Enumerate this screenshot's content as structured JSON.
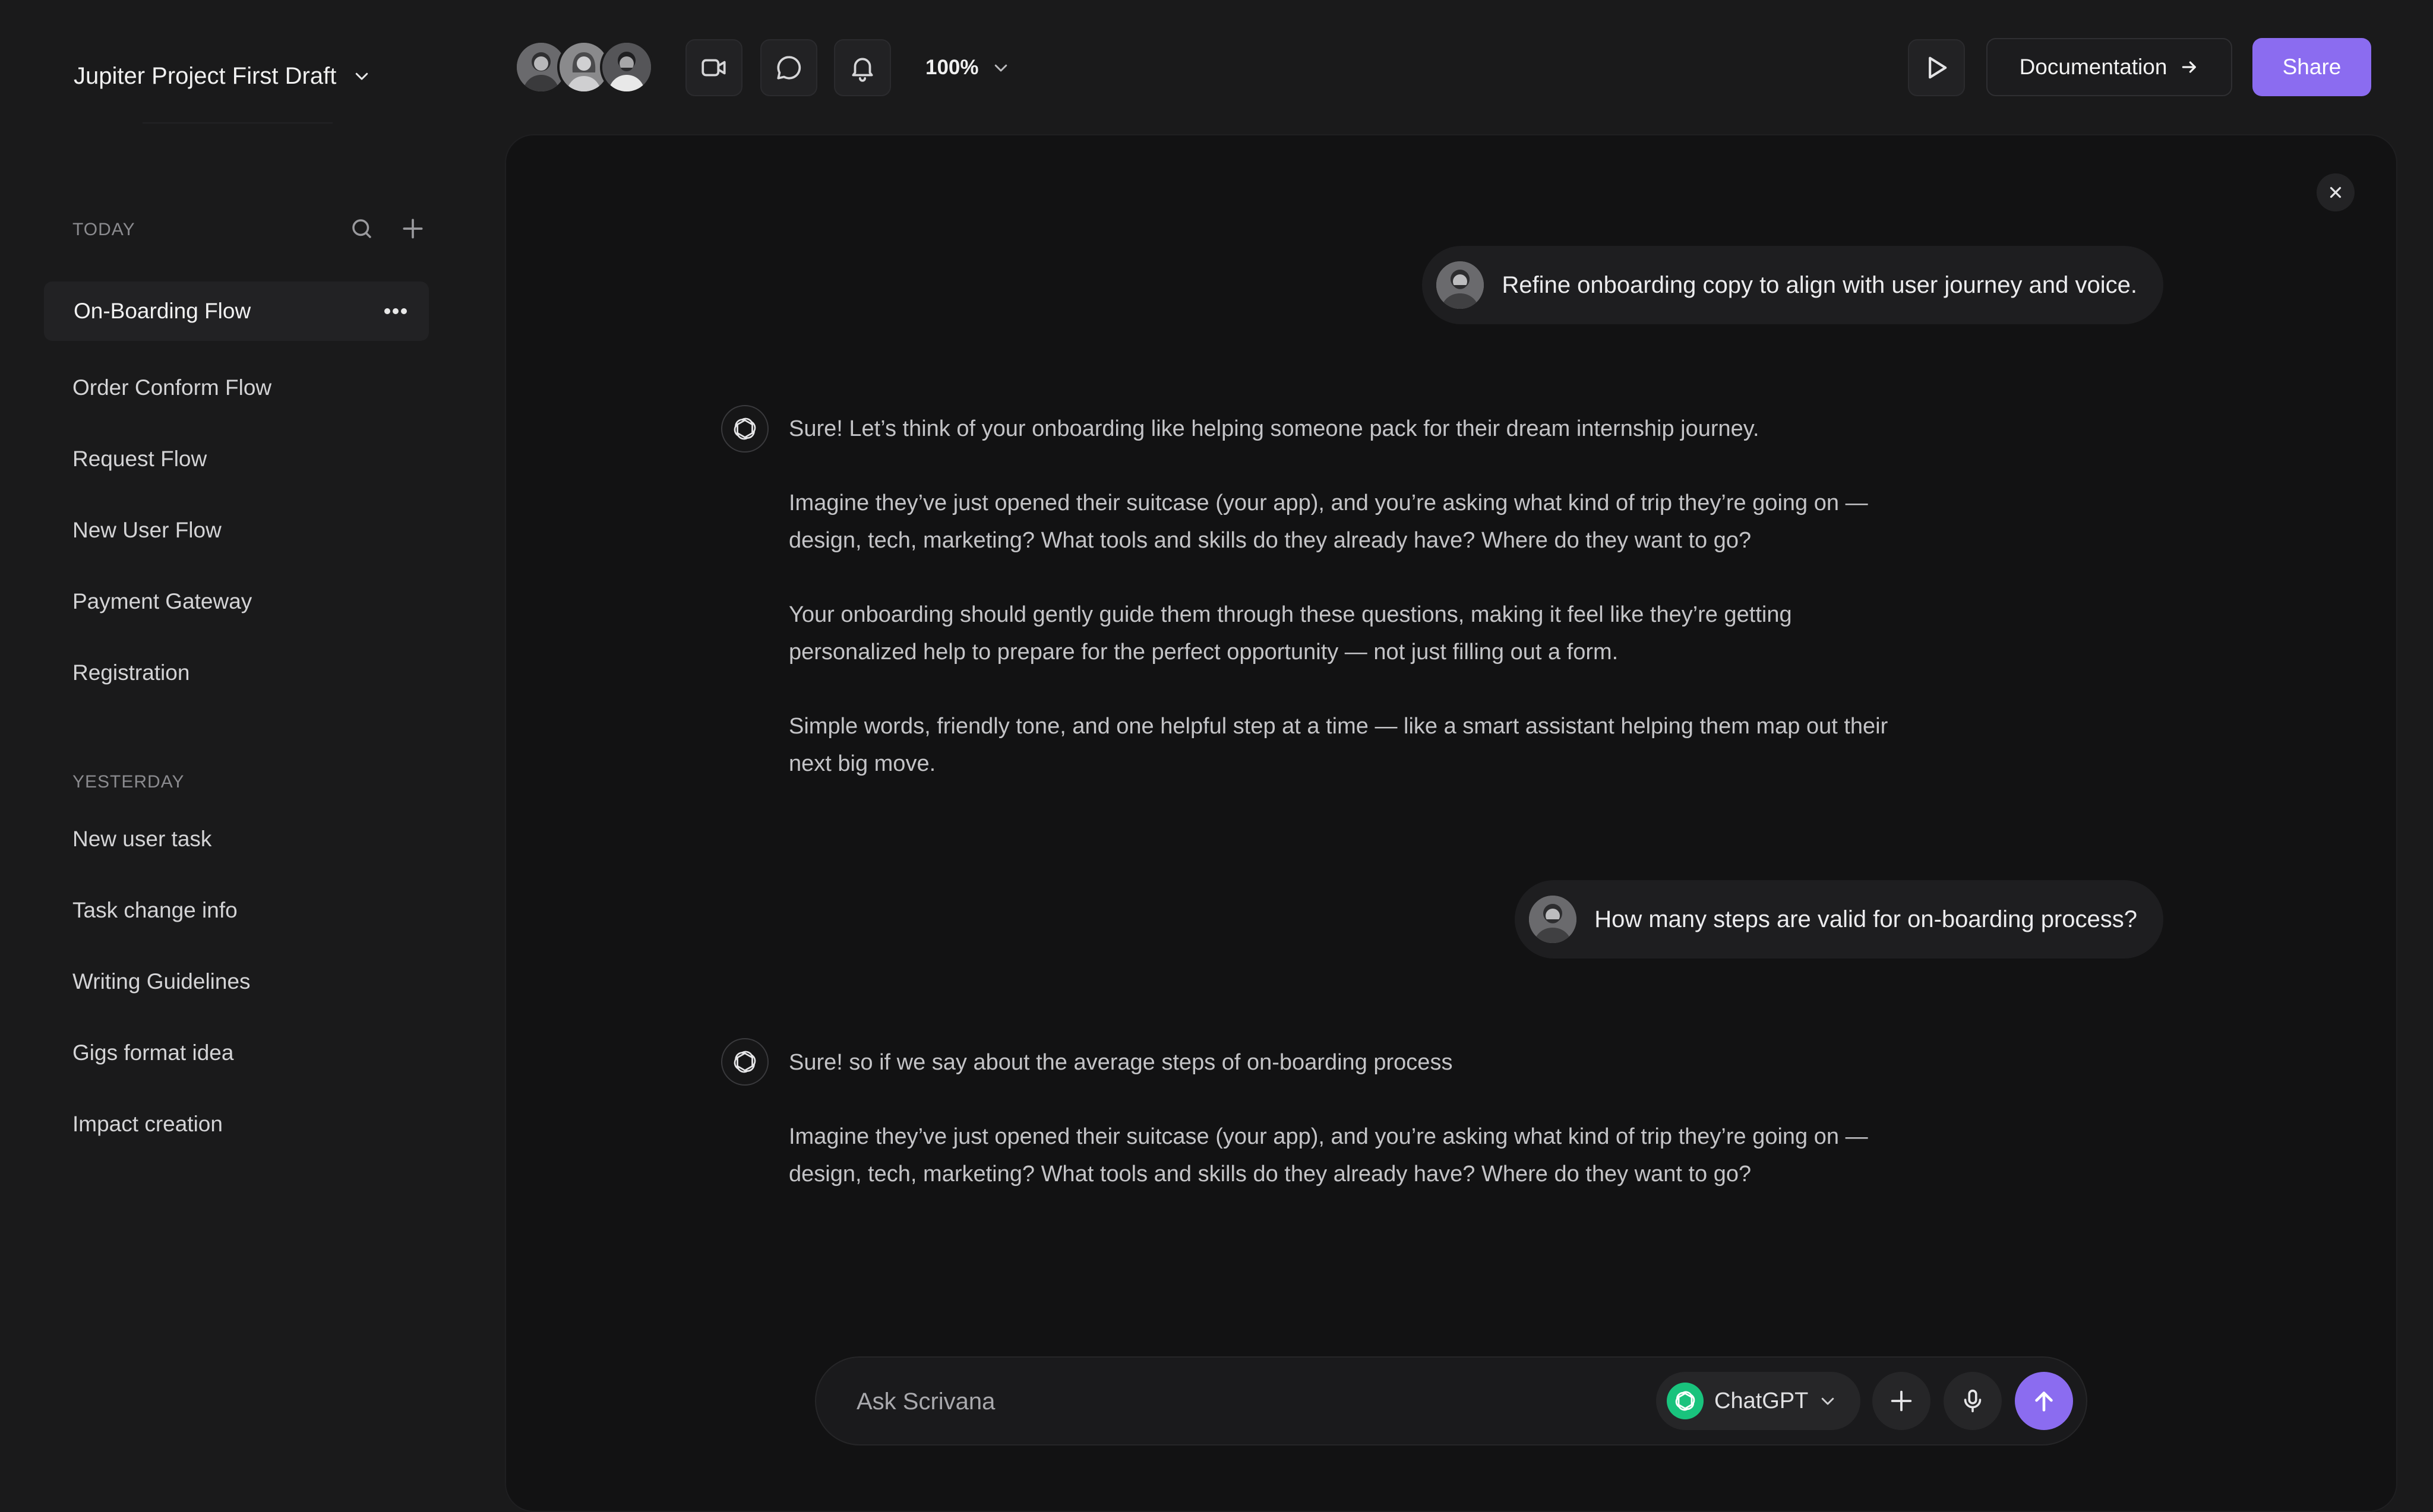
{
  "sidebar": {
    "project_title": "Jupiter Project First Draft",
    "today_label": "TODAY",
    "today_items": [
      {
        "label": "On-Boarding Flow",
        "active": true
      },
      {
        "label": "Order Conform Flow"
      },
      {
        "label": "Request Flow"
      },
      {
        "label": "New User Flow"
      },
      {
        "label": "Payment Gateway"
      },
      {
        "label": "Registration"
      }
    ],
    "yesterday_label": "YESTERDAY",
    "yesterday_items": [
      {
        "label": "New user task"
      },
      {
        "label": "Task change info"
      },
      {
        "label": "Writing Guidelines"
      },
      {
        "label": "Gigs format idea"
      },
      {
        "label": "Impact creation"
      }
    ]
  },
  "topbar": {
    "zoom": "100%",
    "documentation_label": "Documentation",
    "share_label": "Share"
  },
  "chat": {
    "messages": [
      {
        "role": "user",
        "text": "Refine onboarding copy to align with user journey and voice."
      },
      {
        "role": "assistant",
        "paragraphs": [
          "Sure! Let’s think of your onboarding like helping someone pack for their dream internship journey.",
          "Imagine they’ve just opened their suitcase (your app), and you’re asking what kind of trip they’re going on — design, tech, marketing? What tools and skills do they already have? Where do they want to go?",
          "Your onboarding should gently guide them through these questions, making it feel like they’re getting personalized help to prepare for the perfect opportunity — not just filling out a form.",
          "Simple words, friendly tone, and one helpful step at a time — like a smart assistant helping them map out their next big move."
        ]
      },
      {
        "role": "user",
        "text": "How many steps are valid for on-boarding process?"
      },
      {
        "role": "assistant",
        "paragraphs": [
          "Sure! so if we say about the average steps of on-boarding process",
          "Imagine they’ve just opened their suitcase (your app), and you’re asking what kind of trip they’re going on — design, tech, marketing? What tools and skills do they already have? Where do they want to go?"
        ]
      }
    ]
  },
  "composer": {
    "placeholder": "Ask Scrivana",
    "model": "ChatGPT"
  },
  "colors": {
    "background": "#1a1a1b",
    "panel": "#121213",
    "accent": "#8b6cf0",
    "chatgpt_green": "#19c37d"
  }
}
